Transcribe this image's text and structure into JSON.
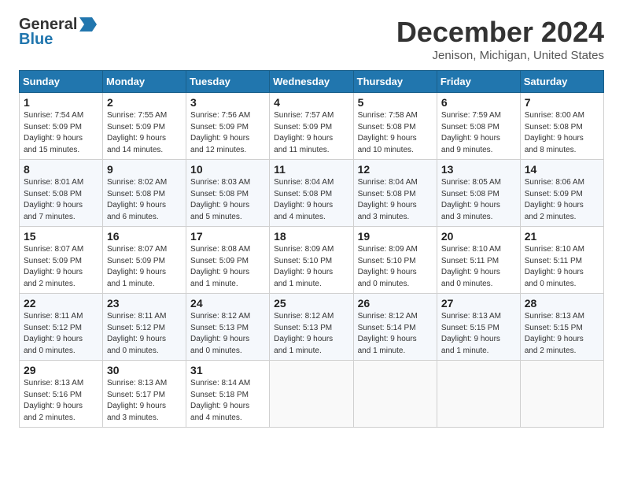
{
  "logo": {
    "general": "General",
    "blue": "Blue"
  },
  "title": {
    "month_year": "December 2024",
    "location": "Jenison, Michigan, United States"
  },
  "weekdays": [
    "Sunday",
    "Monday",
    "Tuesday",
    "Wednesday",
    "Thursday",
    "Friday",
    "Saturday"
  ],
  "weeks": [
    [
      {
        "day": "1",
        "info": "Sunrise: 7:54 AM\nSunset: 5:09 PM\nDaylight: 9 hours\nand 15 minutes."
      },
      {
        "day": "2",
        "info": "Sunrise: 7:55 AM\nSunset: 5:09 PM\nDaylight: 9 hours\nand 14 minutes."
      },
      {
        "day": "3",
        "info": "Sunrise: 7:56 AM\nSunset: 5:09 PM\nDaylight: 9 hours\nand 12 minutes."
      },
      {
        "day": "4",
        "info": "Sunrise: 7:57 AM\nSunset: 5:09 PM\nDaylight: 9 hours\nand 11 minutes."
      },
      {
        "day": "5",
        "info": "Sunrise: 7:58 AM\nSunset: 5:08 PM\nDaylight: 9 hours\nand 10 minutes."
      },
      {
        "day": "6",
        "info": "Sunrise: 7:59 AM\nSunset: 5:08 PM\nDaylight: 9 hours\nand 9 minutes."
      },
      {
        "day": "7",
        "info": "Sunrise: 8:00 AM\nSunset: 5:08 PM\nDaylight: 9 hours\nand 8 minutes."
      }
    ],
    [
      {
        "day": "8",
        "info": "Sunrise: 8:01 AM\nSunset: 5:08 PM\nDaylight: 9 hours\nand 7 minutes."
      },
      {
        "day": "9",
        "info": "Sunrise: 8:02 AM\nSunset: 5:08 PM\nDaylight: 9 hours\nand 6 minutes."
      },
      {
        "day": "10",
        "info": "Sunrise: 8:03 AM\nSunset: 5:08 PM\nDaylight: 9 hours\nand 5 minutes."
      },
      {
        "day": "11",
        "info": "Sunrise: 8:04 AM\nSunset: 5:08 PM\nDaylight: 9 hours\nand 4 minutes."
      },
      {
        "day": "12",
        "info": "Sunrise: 8:04 AM\nSunset: 5:08 PM\nDaylight: 9 hours\nand 3 minutes."
      },
      {
        "day": "13",
        "info": "Sunrise: 8:05 AM\nSunset: 5:08 PM\nDaylight: 9 hours\nand 3 minutes."
      },
      {
        "day": "14",
        "info": "Sunrise: 8:06 AM\nSunset: 5:09 PM\nDaylight: 9 hours\nand 2 minutes."
      }
    ],
    [
      {
        "day": "15",
        "info": "Sunrise: 8:07 AM\nSunset: 5:09 PM\nDaylight: 9 hours\nand 2 minutes."
      },
      {
        "day": "16",
        "info": "Sunrise: 8:07 AM\nSunset: 5:09 PM\nDaylight: 9 hours\nand 1 minute."
      },
      {
        "day": "17",
        "info": "Sunrise: 8:08 AM\nSunset: 5:09 PM\nDaylight: 9 hours\nand 1 minute."
      },
      {
        "day": "18",
        "info": "Sunrise: 8:09 AM\nSunset: 5:10 PM\nDaylight: 9 hours\nand 1 minute."
      },
      {
        "day": "19",
        "info": "Sunrise: 8:09 AM\nSunset: 5:10 PM\nDaylight: 9 hours\nand 0 minutes."
      },
      {
        "day": "20",
        "info": "Sunrise: 8:10 AM\nSunset: 5:11 PM\nDaylight: 9 hours\nand 0 minutes."
      },
      {
        "day": "21",
        "info": "Sunrise: 8:10 AM\nSunset: 5:11 PM\nDaylight: 9 hours\nand 0 minutes."
      }
    ],
    [
      {
        "day": "22",
        "info": "Sunrise: 8:11 AM\nSunset: 5:12 PM\nDaylight: 9 hours\nand 0 minutes."
      },
      {
        "day": "23",
        "info": "Sunrise: 8:11 AM\nSunset: 5:12 PM\nDaylight: 9 hours\nand 0 minutes."
      },
      {
        "day": "24",
        "info": "Sunrise: 8:12 AM\nSunset: 5:13 PM\nDaylight: 9 hours\nand 0 minutes."
      },
      {
        "day": "25",
        "info": "Sunrise: 8:12 AM\nSunset: 5:13 PM\nDaylight: 9 hours\nand 1 minute."
      },
      {
        "day": "26",
        "info": "Sunrise: 8:12 AM\nSunset: 5:14 PM\nDaylight: 9 hours\nand 1 minute."
      },
      {
        "day": "27",
        "info": "Sunrise: 8:13 AM\nSunset: 5:15 PM\nDaylight: 9 hours\nand 1 minute."
      },
      {
        "day": "28",
        "info": "Sunrise: 8:13 AM\nSunset: 5:15 PM\nDaylight: 9 hours\nand 2 minutes."
      }
    ],
    [
      {
        "day": "29",
        "info": "Sunrise: 8:13 AM\nSunset: 5:16 PM\nDaylight: 9 hours\nand 2 minutes."
      },
      {
        "day": "30",
        "info": "Sunrise: 8:13 AM\nSunset: 5:17 PM\nDaylight: 9 hours\nand 3 minutes."
      },
      {
        "day": "31",
        "info": "Sunrise: 8:14 AM\nSunset: 5:18 PM\nDaylight: 9 hours\nand 4 minutes."
      },
      null,
      null,
      null,
      null
    ]
  ]
}
